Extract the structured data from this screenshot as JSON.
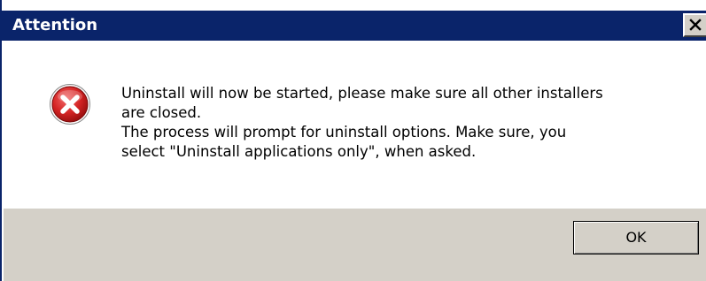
{
  "window": {
    "title": "Attention",
    "close_icon": "close-icon",
    "title_bar_color": "#0a246a"
  },
  "message": {
    "icon": "error-icon",
    "icon_color": "#cc1f1f",
    "lines": [
      "Uninstall will now be started, please make sure all other installers",
      "are closed.",
      "The process will prompt for uninstall options. Make sure, you",
      "select \"Uninstall applications only\", when asked."
    ]
  },
  "buttons": {
    "ok_label": "OK"
  }
}
